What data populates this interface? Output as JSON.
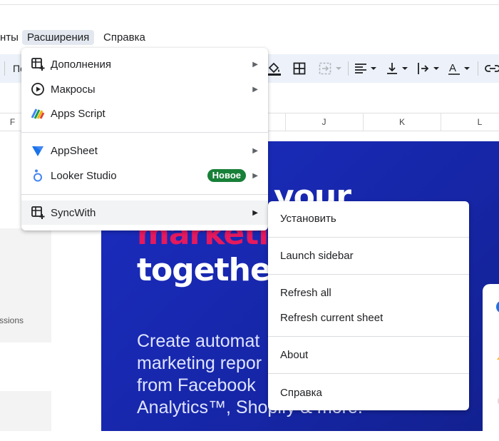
{
  "menubar": {
    "items": [
      "нты",
      "Расширения",
      "Справка"
    ]
  },
  "toolbar": {
    "font_trunc": "По"
  },
  "columns": [
    "F",
    "J",
    "K",
    "L"
  ],
  "sheet": {
    "partial_text": "ssions"
  },
  "banner": {
    "line1": "your",
    "line2": "marketi",
    "line3": "together",
    "body": [
      "Create automat",
      "marketing repor",
      "from Facebook",
      "Analytics™, Shopify & more."
    ],
    "colors": {
      "background": "#1b2cc0",
      "accent": "#e5195e"
    }
  },
  "extensions_menu": {
    "items": [
      {
        "label": "Дополнения",
        "icon": "addons-icon",
        "submenu": true
      },
      {
        "label": "Макросы",
        "icon": "play-circle-icon",
        "submenu": true
      },
      {
        "label": "Apps Script",
        "icon": "apps-script-icon",
        "submenu": false
      },
      {
        "label": "AppSheet",
        "icon": "appsheet-icon",
        "submenu": true
      },
      {
        "label": "Looker Studio",
        "icon": "looker-studio-icon",
        "submenu": true,
        "badge": "Новое"
      },
      {
        "label": "SyncWith",
        "icon": "syncwith-icon",
        "submenu": true
      }
    ]
  },
  "syncwith_submenu": {
    "items": [
      "Установить",
      "Launch sidebar",
      "Refresh all",
      "Refresh current sheet",
      "About",
      "Справка"
    ]
  }
}
